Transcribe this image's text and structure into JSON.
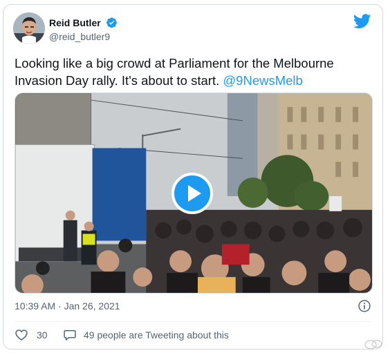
{
  "tweet": {
    "display_name": "Reid Butler",
    "handle": "@reid_butler9",
    "text_before_mention": "Looking like a big crowd at Parliament for the Melbourne Invasion Day rally. It's about to start.",
    "mention": "@9NewsMelb",
    "timestamp": "10:39 AM · Jan 26, 2021",
    "like_count": "30",
    "reply_text": "49 people are Tweeting about this"
  },
  "icons": {
    "verified": "verified-badge-icon",
    "brand": "twitter-bird-icon",
    "play": "play-icon",
    "info": "info-icon",
    "like": "heart-icon",
    "reply": "speech-bubble-icon"
  },
  "colors": {
    "accent": "#1d9bf0",
    "text": "#0f1419",
    "secondary": "#536471",
    "border": "#cfd9de"
  }
}
